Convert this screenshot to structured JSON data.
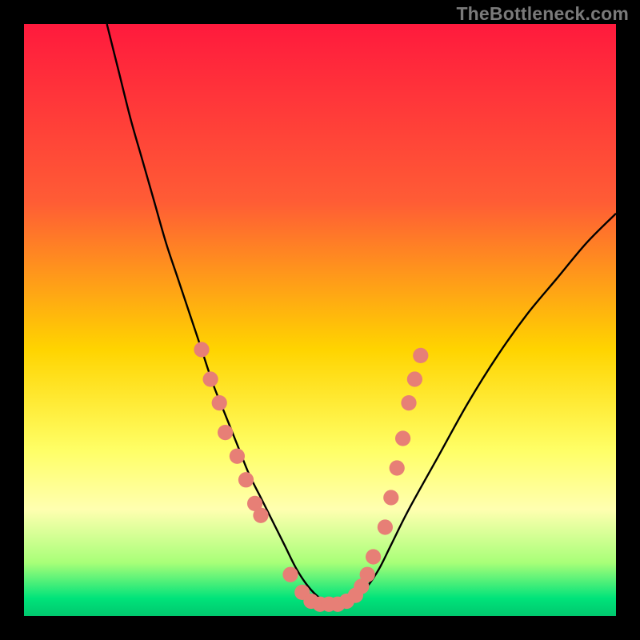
{
  "watermark": {
    "text": "TheBottleneck.com"
  },
  "chart_data": {
    "type": "line",
    "title": "",
    "xlabel": "",
    "ylabel": "",
    "xlim": [
      0,
      100
    ],
    "ylim": [
      0,
      100
    ],
    "grid": false,
    "legend": "none",
    "gradient_stops": [
      {
        "offset": 0.0,
        "color": "#ff1a3d"
      },
      {
        "offset": 0.3,
        "color": "#ff5c35"
      },
      {
        "offset": 0.55,
        "color": "#ffd400"
      },
      {
        "offset": 0.72,
        "color": "#ffff66"
      },
      {
        "offset": 0.82,
        "color": "#ffffb0"
      },
      {
        "offset": 0.91,
        "color": "#a8ff78"
      },
      {
        "offset": 0.97,
        "color": "#00e37a"
      },
      {
        "offset": 1.0,
        "color": "#00c86e"
      }
    ],
    "series": [
      {
        "name": "curve",
        "x": [
          14,
          16,
          18,
          20,
          22,
          24,
          26,
          28,
          30,
          32,
          34,
          36,
          38,
          40,
          42,
          44,
          46,
          48,
          50,
          52,
          54,
          56,
          58,
          60,
          62,
          65,
          70,
          75,
          80,
          85,
          90,
          95,
          100
        ],
        "values": [
          100,
          92,
          84,
          77,
          70,
          63,
          57,
          51,
          45,
          39,
          34,
          29,
          24,
          20,
          16,
          12,
          8,
          5,
          3,
          2,
          2,
          3,
          5,
          8,
          12,
          18,
          27,
          36,
          44,
          51,
          57,
          63,
          68
        ]
      }
    ],
    "markers": [
      {
        "x": 30.0,
        "y": 45
      },
      {
        "x": 31.5,
        "y": 40
      },
      {
        "x": 33.0,
        "y": 36
      },
      {
        "x": 34.0,
        "y": 31
      },
      {
        "x": 36.0,
        "y": 27
      },
      {
        "x": 37.5,
        "y": 23
      },
      {
        "x": 39.0,
        "y": 19
      },
      {
        "x": 40.0,
        "y": 17
      },
      {
        "x": 45.0,
        "y": 7
      },
      {
        "x": 47.0,
        "y": 4
      },
      {
        "x": 48.5,
        "y": 2.5
      },
      {
        "x": 50.0,
        "y": 2
      },
      {
        "x": 51.5,
        "y": 2
      },
      {
        "x": 53.0,
        "y": 2
      },
      {
        "x": 54.5,
        "y": 2.5
      },
      {
        "x": 56.0,
        "y": 3.5
      },
      {
        "x": 57.0,
        "y": 5
      },
      {
        "x": 58.0,
        "y": 7
      },
      {
        "x": 59.0,
        "y": 10
      },
      {
        "x": 61.0,
        "y": 15
      },
      {
        "x": 62.0,
        "y": 20
      },
      {
        "x": 63.0,
        "y": 25
      },
      {
        "x": 64.0,
        "y": 30
      },
      {
        "x": 65.0,
        "y": 36
      },
      {
        "x": 66.0,
        "y": 40
      },
      {
        "x": 67.0,
        "y": 44
      }
    ],
    "marker_style": {
      "radius_pct": 1.3,
      "fill": "#e77f76"
    }
  }
}
